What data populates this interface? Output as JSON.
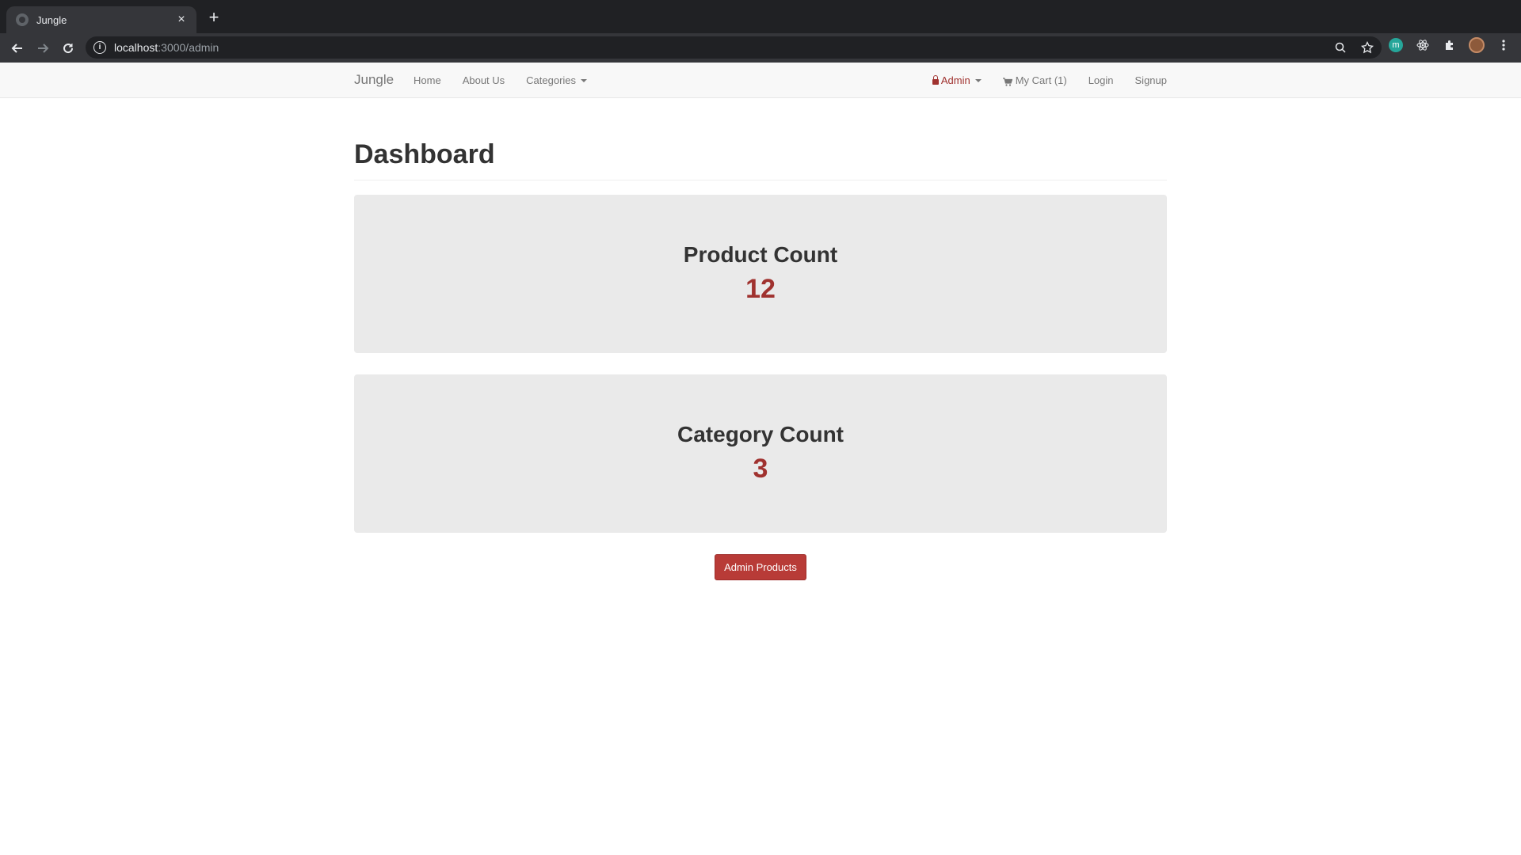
{
  "browser": {
    "tab_title": "Jungle",
    "url_host": "localhost",
    "url_path": ":3000/admin"
  },
  "navbar": {
    "brand": "Jungle",
    "left_items": [
      "Home",
      "About Us",
      "Categories"
    ],
    "admin_label": "Admin",
    "cart_label": "My Cart (1)",
    "login_label": "Login",
    "signup_label": "Signup"
  },
  "page": {
    "title": "Dashboard"
  },
  "panels": [
    {
      "title": "Product Count",
      "count": "12"
    },
    {
      "title": "Category Count",
      "count": "3"
    }
  ],
  "actions": {
    "admin_products_label": "Admin Products"
  },
  "colors": {
    "accent": "#a0322f",
    "button": "#b83b37",
    "panel_bg": "#eaeaea"
  },
  "icons": [
    "back-icon",
    "forward-icon",
    "reload-icon",
    "info-icon",
    "zoom-icon",
    "star-icon",
    "extension-m-icon",
    "react-icon",
    "puzzle-icon",
    "profile-avatar",
    "menu-dots-icon",
    "lock-icon",
    "cart-icon"
  ]
}
